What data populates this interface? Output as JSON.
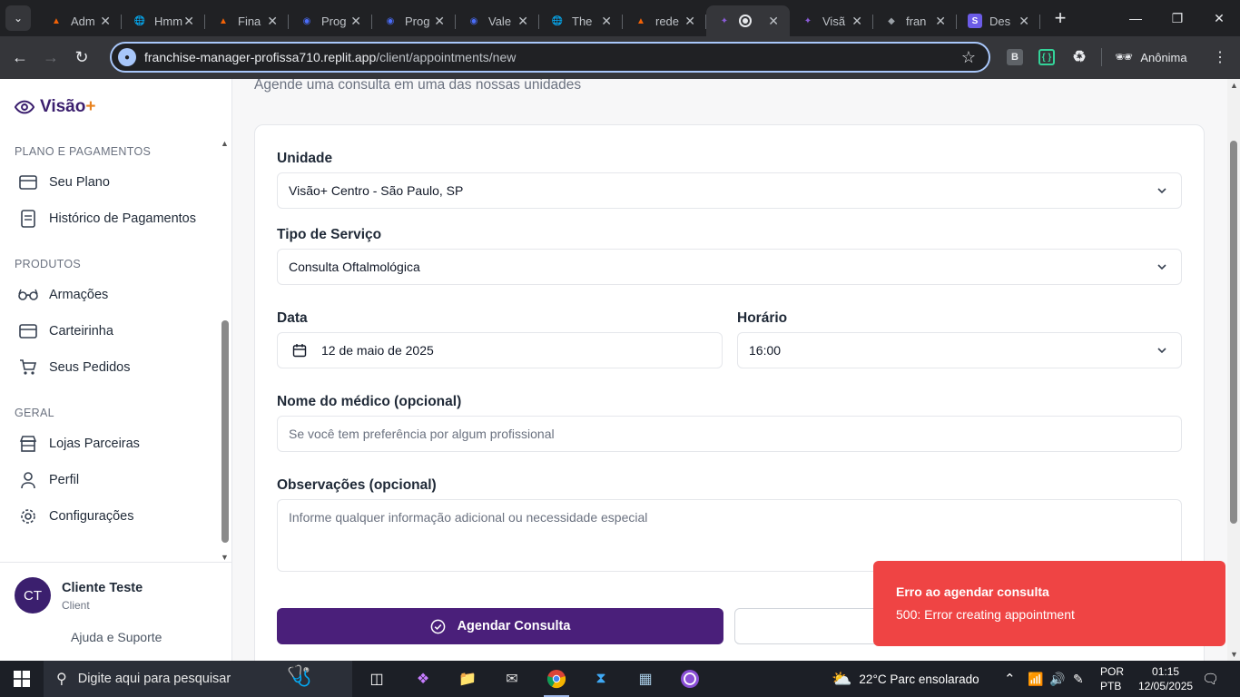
{
  "browser": {
    "tabs": [
      {
        "title": "Adm",
        "favicon": "replit-icon",
        "color": "#f26207"
      },
      {
        "title": "Hmm",
        "favicon": "globe-icon",
        "color": "#9aa0a6"
      },
      {
        "title": "Fina",
        "favicon": "replit-icon",
        "color": "#f26207"
      },
      {
        "title": "Prog",
        "favicon": "firefox-icon",
        "color": "#4a6cf7"
      },
      {
        "title": "Prog",
        "favicon": "firefox-icon",
        "color": "#4a6cf7"
      },
      {
        "title": "Vale",
        "favicon": "firefox-icon",
        "color": "#4a6cf7"
      },
      {
        "title": "The",
        "favicon": "globe-icon",
        "color": "#9aa0a6"
      },
      {
        "title": "rede",
        "favicon": "replit-icon",
        "color": "#f26207"
      },
      {
        "title": "",
        "favicon": "visao-icon",
        "color": "#8a5bd6",
        "active": true
      },
      {
        "title": "Visã",
        "favicon": "visao-icon",
        "color": "#8a5bd6"
      },
      {
        "title": "fran",
        "favicon": "diamond-icon",
        "color": "#9aa0a6"
      },
      {
        "title": "Des",
        "favicon": "s-icon",
        "color": "#6c5ce7"
      }
    ],
    "url_host": "franchise-manager-profissa710.replit.app",
    "url_path": "/client/appointments/new",
    "incognito_label": "Anônima",
    "ext_b_label": "B"
  },
  "sidebar": {
    "brand": "Visão",
    "brand_plus": "+",
    "sections": [
      {
        "title": "PLANO E PAGAMENTOS",
        "items": [
          {
            "label": "Seu Plano",
            "icon": "card-icon"
          },
          {
            "label": "Histórico de Pagamentos",
            "icon": "receipt-icon"
          }
        ]
      },
      {
        "title": "PRODUTOS",
        "items": [
          {
            "label": "Armações",
            "icon": "glasses-icon"
          },
          {
            "label": "Carteirinha",
            "icon": "card-icon"
          },
          {
            "label": "Seus Pedidos",
            "icon": "cart-icon"
          }
        ]
      },
      {
        "title": "GERAL",
        "items": [
          {
            "label": "Lojas Parceiras",
            "icon": "store-icon"
          },
          {
            "label": "Perfil",
            "icon": "user-icon"
          },
          {
            "label": "Configurações",
            "icon": "gear-icon"
          }
        ]
      }
    ],
    "user": {
      "initials": "CT",
      "name": "Cliente Teste",
      "role": "Client"
    },
    "help": "Ajuda e Suporte"
  },
  "main": {
    "subtitle": "Agende uma consulta em uma das nossas unidades",
    "form": {
      "unit_label": "Unidade",
      "unit_value": "Visão+ Centro - São Paulo, SP",
      "service_label": "Tipo de Serviço",
      "service_value": "Consulta Oftalmológica",
      "date_label": "Data",
      "date_value": "12 de maio de 2025",
      "time_label": "Horário",
      "time_value": "16:00",
      "doctor_label": "Nome do médico (opcional)",
      "doctor_placeholder": "Se você tem preferência por algum profissional",
      "notes_label": "Observações (opcional)",
      "notes_placeholder": "Informe qualquer informação adicional ou necessidade especial",
      "submit_label": "Agendar Consulta"
    }
  },
  "toast": {
    "title": "Erro ao agendar consulta",
    "message": "500: Error creating appointment",
    "color": "#ef4444"
  },
  "taskbar": {
    "search_placeholder": "Digite aqui para pesquisar",
    "weather": "22°C  Parc ensolarado",
    "lang_1": "POR",
    "lang_2": "PTB",
    "time": "01:15",
    "date": "12/05/2025"
  },
  "colors": {
    "brand": "#3b1f6e",
    "primary_button": "#4a1f7a",
    "accent": "#e8821e"
  }
}
